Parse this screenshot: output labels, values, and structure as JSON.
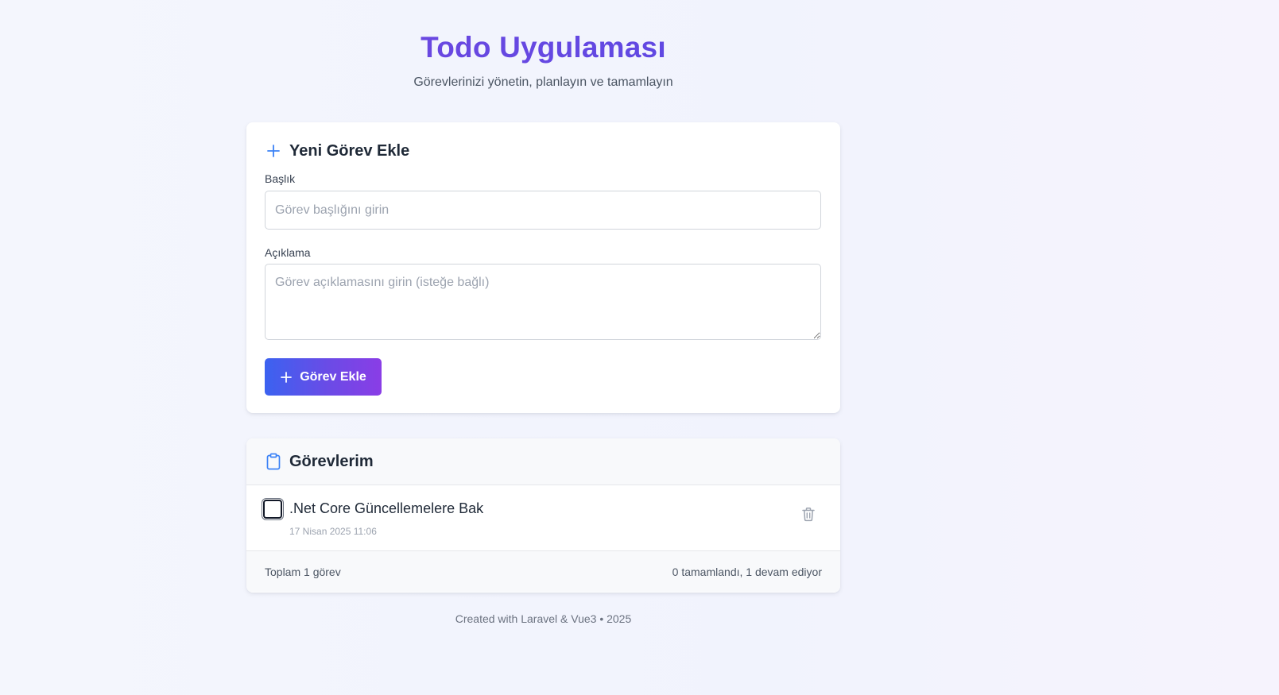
{
  "header": {
    "title": "Todo Uygulaması",
    "subtitle": "Görevlerinizi yönetin, planlayın ve tamamlayın"
  },
  "add_form": {
    "heading": "Yeni Görev Ekle",
    "heading_icon": "plus-icon",
    "title_label": "Başlık",
    "title_placeholder": "Görev başlığını girin",
    "title_value": "",
    "description_label": "Açıklama",
    "description_placeholder": "Görev açıklamasını girin (isteğe bağlı)",
    "description_value": "",
    "submit_label": "Görev Ekle",
    "submit_icon": "plus-icon"
  },
  "task_list": {
    "heading": "Görevlerim",
    "heading_icon": "clipboard-icon",
    "tasks": [
      {
        "title": ".Net Core Güncellemelere Bak",
        "date": "17 Nisan 2025 11:06",
        "completed": false,
        "delete_icon": "trash-icon"
      }
    ],
    "total_label": "Toplam 1 görev",
    "summary_label": "0 tamamlandı, 1 devam ediyor"
  },
  "footer": {
    "text": "Created with Laravel & Vue3 • 2025"
  },
  "colors": {
    "accent_blue": "#3b62f0",
    "accent_purple": "#8a3de6",
    "title_gradient_start": "#7047e0",
    "icon_blue": "#3b82f6"
  }
}
